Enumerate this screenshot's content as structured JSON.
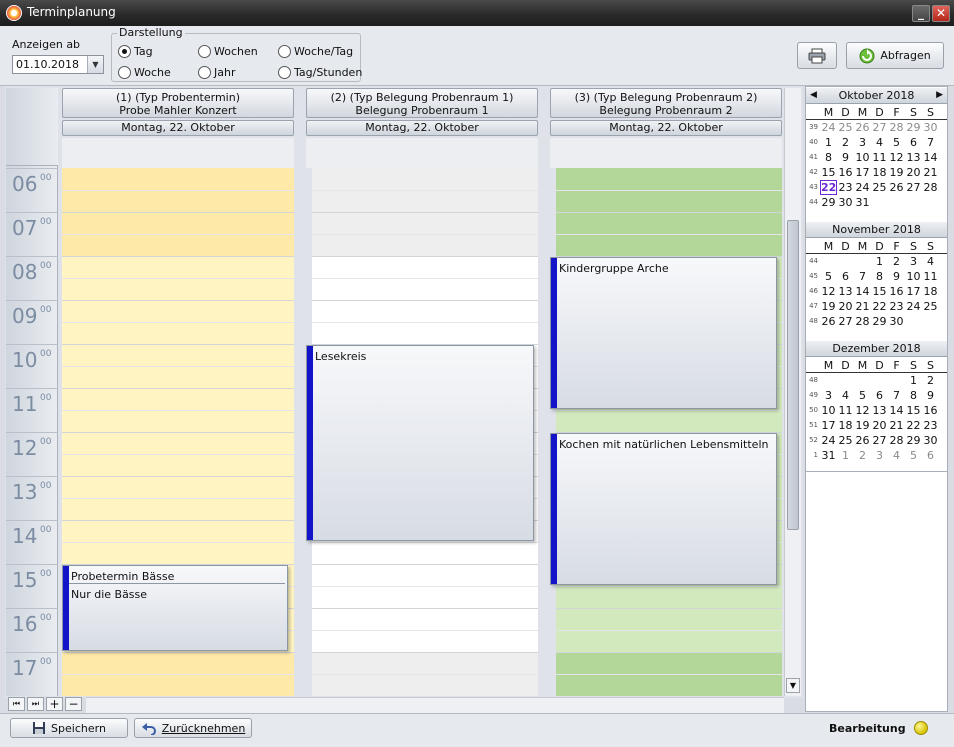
{
  "window": {
    "title": "Terminplanung",
    "minimize": "_",
    "close": "✕"
  },
  "toolbar": {
    "anzeigen_label": "Anzeigen ab",
    "date_value": "01.10.2018",
    "darstellung_label": "Darstellung",
    "options": [
      "Tag",
      "Wochen",
      "Woche/Tag",
      "Woche",
      "Jahr",
      "Tag/Stunden"
    ],
    "selected": "Tag",
    "print_icon": "printer-icon",
    "abfragen_label": "Abfragen"
  },
  "timeline": {
    "hours": [
      "06",
      "07",
      "08",
      "09",
      "10",
      "11",
      "12",
      "13",
      "14",
      "15",
      "16",
      "17"
    ],
    "minutes": "00"
  },
  "columns": [
    {
      "line1": "(1)  (Typ Probentermin)",
      "line2": "Probe Mahler Konzert",
      "day": "Montag, 22. Oktober",
      "color": "#fff2bf"
    },
    {
      "line1": "(2)  (Typ Belegung Probenraum 1)",
      "line2": "Belegung Probenraum 1",
      "day": "Montag, 22. Oktober",
      "color": "#ffffff"
    },
    {
      "line1": "(3)  (Typ Belegung Probenraum 2)",
      "line2": "Belegung Probenraum 2",
      "day": "Montag, 22. Oktober",
      "color": "#cfe6b8"
    }
  ],
  "appointments": [
    {
      "title": "Probetermin Bässe",
      "note": "Nur die Bässe"
    },
    {
      "title": "Lesekreis"
    },
    {
      "title": "Kindergruppe Arche"
    },
    {
      "title": "Kochen mit natürlichen Lebensmitteln"
    }
  ],
  "mini_calendar": {
    "dow": [
      "M",
      "D",
      "M",
      "D",
      "F",
      "S",
      "S"
    ],
    "prev": "◀",
    "next": "▶",
    "months": [
      {
        "name": "Oktober 2018",
        "weeks": [
          {
            "wk": "39",
            "days": [
              "24",
              "25",
              "26",
              "27",
              "28",
              "29",
              "30"
            ]
          },
          {
            "wk": "40",
            "days": [
              "1",
              "2",
              "3",
              "4",
              "5",
              "6",
              "7"
            ]
          },
          {
            "wk": "41",
            "days": [
              "8",
              "9",
              "10",
              "11",
              "12",
              "13",
              "14"
            ]
          },
          {
            "wk": "42",
            "days": [
              "15",
              "16",
              "17",
              "18",
              "19",
              "20",
              "21"
            ]
          },
          {
            "wk": "43",
            "days": [
              "22",
              "23",
              "24",
              "25",
              "26",
              "27",
              "28"
            ]
          },
          {
            "wk": "44",
            "days": [
              "29",
              "30",
              "31",
              "",
              "",
              "",
              ""
            ]
          }
        ]
      },
      {
        "name": "November 2018",
        "weeks": [
          {
            "wk": "44",
            "days": [
              "",
              "",
              "",
              "1",
              "2",
              "3",
              "4"
            ]
          },
          {
            "wk": "45",
            "days": [
              "5",
              "6",
              "7",
              "8",
              "9",
              "10",
              "11"
            ]
          },
          {
            "wk": "46",
            "days": [
              "12",
              "13",
              "14",
              "15",
              "16",
              "17",
              "18"
            ]
          },
          {
            "wk": "47",
            "days": [
              "19",
              "20",
              "21",
              "22",
              "23",
              "24",
              "25"
            ]
          },
          {
            "wk": "48",
            "days": [
              "26",
              "27",
              "28",
              "29",
              "30",
              "",
              ""
            ]
          }
        ]
      },
      {
        "name": "Dezember 2018",
        "weeks": [
          {
            "wk": "48",
            "days": [
              "",
              "",
              "",
              "",
              "",
              "1",
              "2"
            ]
          },
          {
            "wk": "49",
            "days": [
              "3",
              "4",
              "5",
              "6",
              "7",
              "8",
              "9"
            ]
          },
          {
            "wk": "50",
            "days": [
              "10",
              "11",
              "12",
              "13",
              "14",
              "15",
              "16"
            ]
          },
          {
            "wk": "51",
            "days": [
              "17",
              "18",
              "19",
              "20",
              "21",
              "22",
              "23"
            ]
          },
          {
            "wk": "52",
            "days": [
              "24",
              "25",
              "26",
              "27",
              "28",
              "29",
              "30"
            ]
          },
          {
            "wk": "1",
            "days": [
              "31",
              "1",
              "2",
              "3",
              "4",
              "5",
              "6"
            ]
          }
        ]
      }
    ],
    "today": "22"
  },
  "statusbar": {
    "save_label": "Speichern",
    "undo_label": "Zurücknehmen",
    "mode_label": "Bearbeitung"
  }
}
